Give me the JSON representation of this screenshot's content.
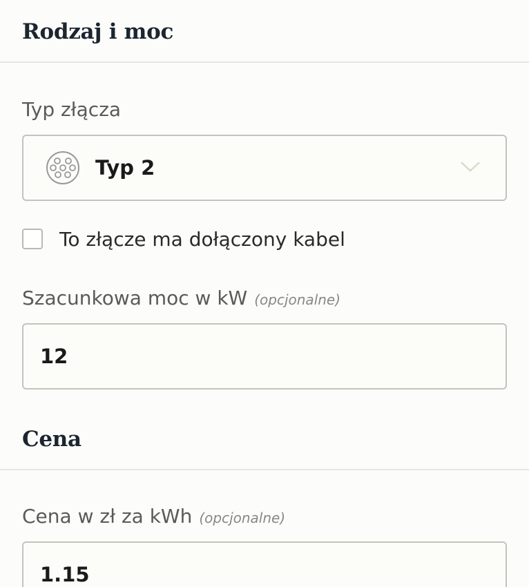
{
  "sections": {
    "type_power": {
      "title": "Rodzaj i moc"
    },
    "price": {
      "title": "Cena"
    }
  },
  "connector": {
    "label": "Typ złącza",
    "selected": "Typ 2",
    "icon": "type2-connector-icon"
  },
  "cable_checkbox": {
    "label": "To złącze ma dołączony kabel",
    "checked": false
  },
  "power": {
    "label": "Szacunkowa moc w kW",
    "optional": "(opcjonalne)",
    "value": "12"
  },
  "price_field": {
    "label": "Cena w zł za kWh",
    "optional": "(opcjonalne)",
    "value": "1.15"
  }
}
